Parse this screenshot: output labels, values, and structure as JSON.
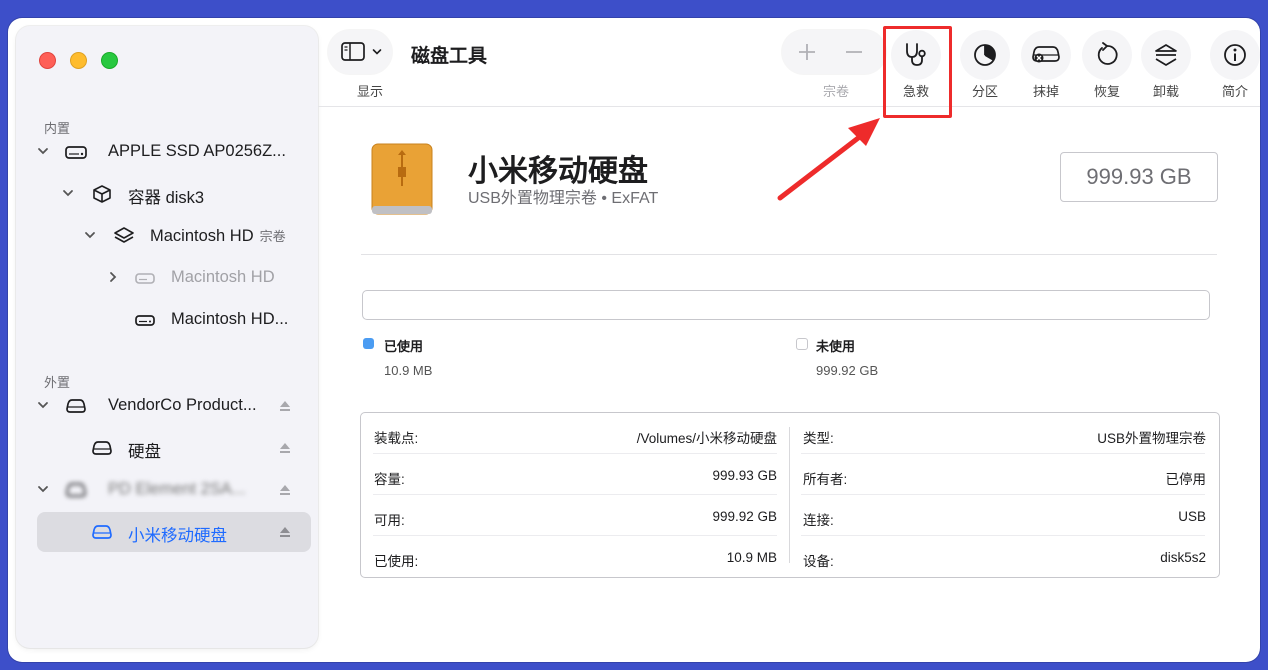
{
  "toolbar": {
    "app_title": "磁盘工具",
    "view_label": "显示",
    "volume_label": "宗卷",
    "firstaid_label": "急救",
    "partition_label": "分区",
    "erase_label": "抹掉",
    "restore_label": "恢复",
    "unmount_label": "卸载",
    "info_label": "简介"
  },
  "sidebar": {
    "internal_label": "内置",
    "external_label": "外置",
    "items": [
      {
        "label": "APPLE SSD AP0256Z..."
      },
      {
        "label": "容器 disk3"
      },
      {
        "label": "Macintosh HD",
        "sub": "宗卷"
      },
      {
        "label": "Macintosh HD"
      },
      {
        "label": "Macintosh HD..."
      },
      {
        "label": "VendorCo Product..."
      },
      {
        "label": "硬盘"
      },
      {
        "label": "PD Element 2SA..."
      },
      {
        "label": "小米移动硬盘"
      }
    ]
  },
  "volume": {
    "name": "小米移动硬盘",
    "description": "USB外置物理宗卷 • ExFAT",
    "capacity": "999.93 GB",
    "used_fraction": 0.0
  },
  "legend": {
    "used_label": "已使用",
    "used_value": "10.9 MB",
    "free_label": "未使用",
    "free_value": "999.92 GB"
  },
  "info": {
    "left": [
      {
        "key": "装载点:",
        "value": "/Volumes/小米移动硬盘"
      },
      {
        "key": "容量:",
        "value": "999.93 GB"
      },
      {
        "key": "可用:",
        "value": "999.92 GB"
      },
      {
        "key": "已使用:",
        "value": "10.9 MB"
      }
    ],
    "right": [
      {
        "key": "类型:",
        "value": "USB外置物理宗卷"
      },
      {
        "key": "所有者:",
        "value": "已停用"
      },
      {
        "key": "连接:",
        "value": "USB"
      },
      {
        "key": "设备:",
        "value": "disk5s2"
      }
    ]
  },
  "colors": {
    "accent": "#1f6bff",
    "used": "#4b9cf2",
    "annotation": "#ee2b2b"
  }
}
